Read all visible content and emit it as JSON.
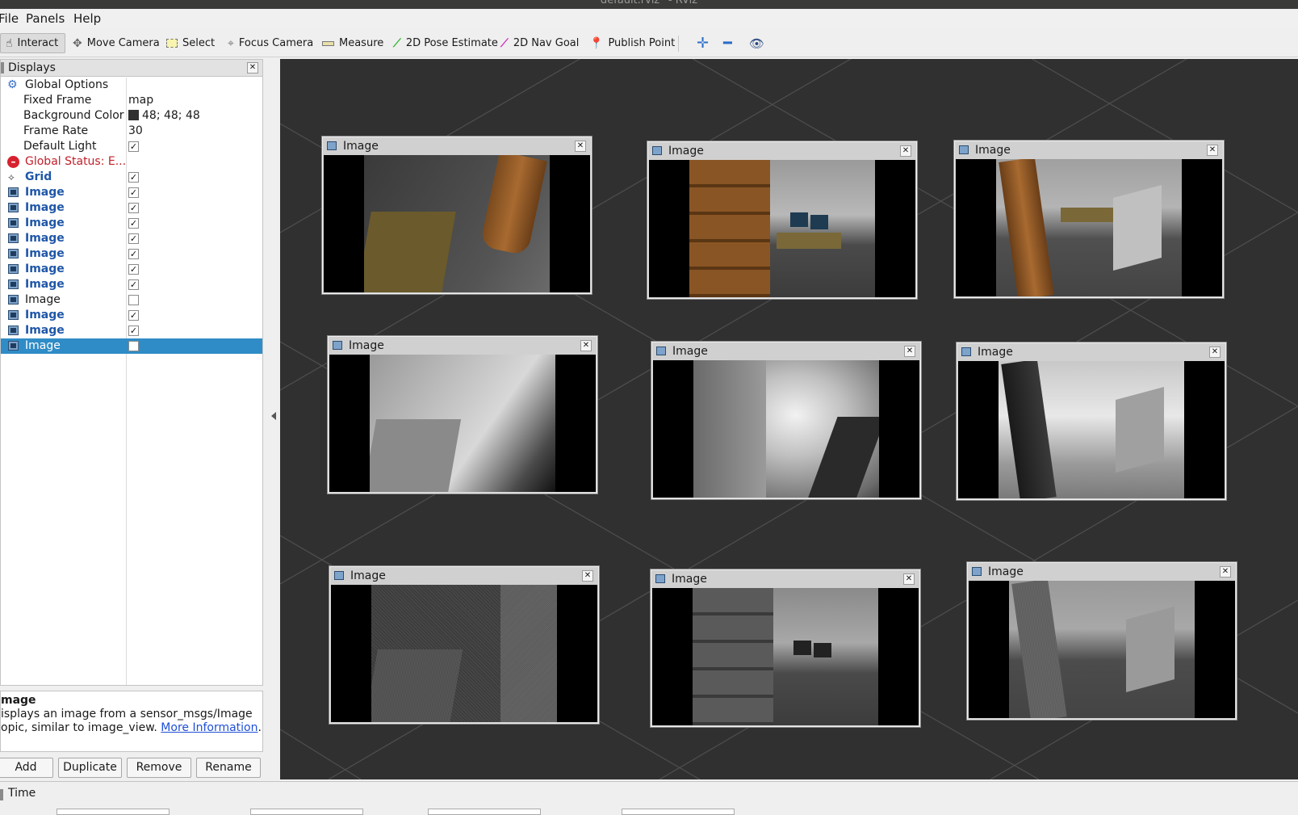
{
  "window": {
    "title": "default.rviz* - RViz"
  },
  "menu": [
    "File",
    "Panels",
    "Help"
  ],
  "toolbar": {
    "tools": [
      {
        "label": "Interact",
        "icon": "hand-icon",
        "active": true
      },
      {
        "label": "Move Camera",
        "icon": "move-camera-icon"
      },
      {
        "label": "Select",
        "icon": "select-icon"
      },
      {
        "label": "Focus Camera",
        "icon": "focus-camera-icon"
      },
      {
        "label": "Measure",
        "icon": "ruler-icon"
      },
      {
        "label": "2D Pose Estimate",
        "icon": "green-arrow-icon"
      },
      {
        "label": "2D Nav Goal",
        "icon": "pink-arrow-icon"
      },
      {
        "label": "Publish Point",
        "icon": "map-pin-icon"
      }
    ]
  },
  "displays": {
    "title": "Displays",
    "rows": [
      {
        "label": "Global Options",
        "value": "",
        "kind": "options"
      },
      {
        "label": "Fixed Frame",
        "value": "map",
        "kind": "prop"
      },
      {
        "label": "Background Color",
        "value": "48; 48; 48",
        "kind": "color"
      },
      {
        "label": "Frame Rate",
        "value": "30",
        "kind": "prop"
      },
      {
        "label": "Default Light",
        "value": "",
        "kind": "check",
        "checked": true
      },
      {
        "label": "Global Status: E...",
        "value": "",
        "kind": "error"
      },
      {
        "label": "Grid",
        "value": "",
        "kind": "grid",
        "checked": true
      },
      {
        "label": "Image",
        "kind": "image",
        "checked": true
      },
      {
        "label": "Image",
        "kind": "image",
        "checked": true
      },
      {
        "label": "Image",
        "kind": "image",
        "checked": true
      },
      {
        "label": "Image",
        "kind": "image",
        "checked": true
      },
      {
        "label": "Image",
        "kind": "image",
        "checked": true
      },
      {
        "label": "Image",
        "kind": "image",
        "checked": true
      },
      {
        "label": "Image",
        "kind": "image",
        "checked": true
      },
      {
        "label": "Image",
        "kind": "image-off",
        "checked": false
      },
      {
        "label": "Image",
        "kind": "image",
        "checked": true
      },
      {
        "label": "Image",
        "kind": "image",
        "checked": true
      },
      {
        "label": "Image",
        "kind": "image-sel",
        "checked": false
      }
    ]
  },
  "description": {
    "heading": "mage",
    "line1": "isplays an image from a sensor_msgs/Image",
    "line2": "opic, similar to image_view. ",
    "link": "More Information",
    "end": "."
  },
  "buttons": [
    "Add",
    "Duplicate",
    "Remove",
    "Rename"
  ],
  "viewport": {
    "background": "#303030",
    "image_windows": [
      {
        "title": "Image",
        "style": "rgb"
      },
      {
        "title": "Image",
        "style": "rgb"
      },
      {
        "title": "Image",
        "style": "rgb"
      },
      {
        "title": "Image",
        "style": "depth"
      },
      {
        "title": "Image",
        "style": "depth"
      },
      {
        "title": "Image",
        "style": "depth"
      },
      {
        "title": "Image",
        "style": "noise"
      },
      {
        "title": "Image",
        "style": "noise"
      },
      {
        "title": "Image",
        "style": "noise"
      }
    ]
  },
  "time_panel": {
    "title": "Time"
  }
}
